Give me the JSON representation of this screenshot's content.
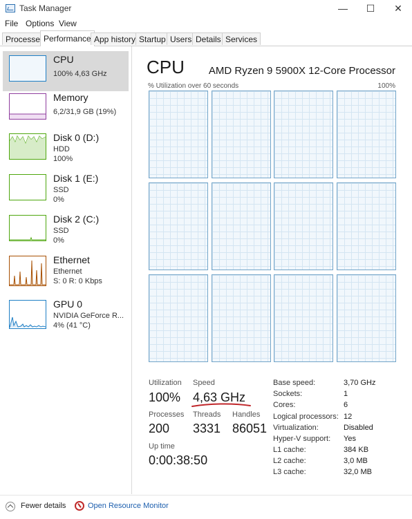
{
  "window": {
    "title": "Task Manager",
    "minimize": "—",
    "maximize": "☐",
    "close": "✕"
  },
  "menu": [
    "File",
    "Options",
    "View"
  ],
  "tabs": [
    "Processes",
    "Performance",
    "App history",
    "Startup",
    "Users",
    "Details",
    "Services"
  ],
  "active_tab": "Performance",
  "sidebar": [
    {
      "name": "CPU",
      "sub1": "100% 4,63 GHz",
      "color": "#1e7fc5"
    },
    {
      "name": "Memory",
      "sub1": "6,2/31,9 GB (19%)",
      "color": "#8e3c9e"
    },
    {
      "name": "Disk 0 (D:)",
      "sub1": "HDD",
      "sub2": "100%",
      "color": "#4da60c"
    },
    {
      "name": "Disk 1 (E:)",
      "sub1": "SSD",
      "sub2": "0%",
      "color": "#4da60c"
    },
    {
      "name": "Disk 2 (C:)",
      "sub1": "SSD",
      "sub2": "0%",
      "color": "#4da60c"
    },
    {
      "name": "Ethernet",
      "sub1": "Ethernet",
      "sub2": "S: 0 R: 0 Kbps",
      "color": "#a74f01"
    },
    {
      "name": "GPU 0",
      "sub1": "NVIDIA GeForce R...",
      "sub2": "4% (41 °C)",
      "color": "#1e7fc5"
    }
  ],
  "main": {
    "title": "CPU",
    "cpu_model": "AMD Ryzen 9 5900X 12-Core Processor",
    "graph_caption": "% Utilization over 60 seconds",
    "graph_max": "100%"
  },
  "stats": {
    "utilization_label": "Utilization",
    "utilization": "100%",
    "speed_label": "Speed",
    "speed": "4,63 GHz",
    "processes_label": "Processes",
    "processes": "200",
    "threads_label": "Threads",
    "threads": "3331",
    "handles_label": "Handles",
    "handles": "86051",
    "uptime_label": "Up time",
    "uptime": "0:00:38:50"
  },
  "details": [
    {
      "label": "Base speed:",
      "value": "3,70 GHz"
    },
    {
      "label": "Sockets:",
      "value": "1"
    },
    {
      "label": "Cores:",
      "value": "6"
    },
    {
      "label": "Logical processors:",
      "value": "12"
    },
    {
      "label": "Virtualization:",
      "value": "Disabled"
    },
    {
      "label": "Hyper-V support:",
      "value": "Yes"
    },
    {
      "label": "L1 cache:",
      "value": "384 KB"
    },
    {
      "label": "L2 cache:",
      "value": "3,0 MB"
    },
    {
      "label": "L3 cache:",
      "value": "32,0 MB"
    }
  ],
  "footer": {
    "fewer_details": "Fewer details",
    "open_resource_monitor": "Open Resource Monitor"
  },
  "colors": {
    "accent_link": "#1d5fae",
    "graph_border": "#73a5c9",
    "underline": "#c0262a"
  }
}
